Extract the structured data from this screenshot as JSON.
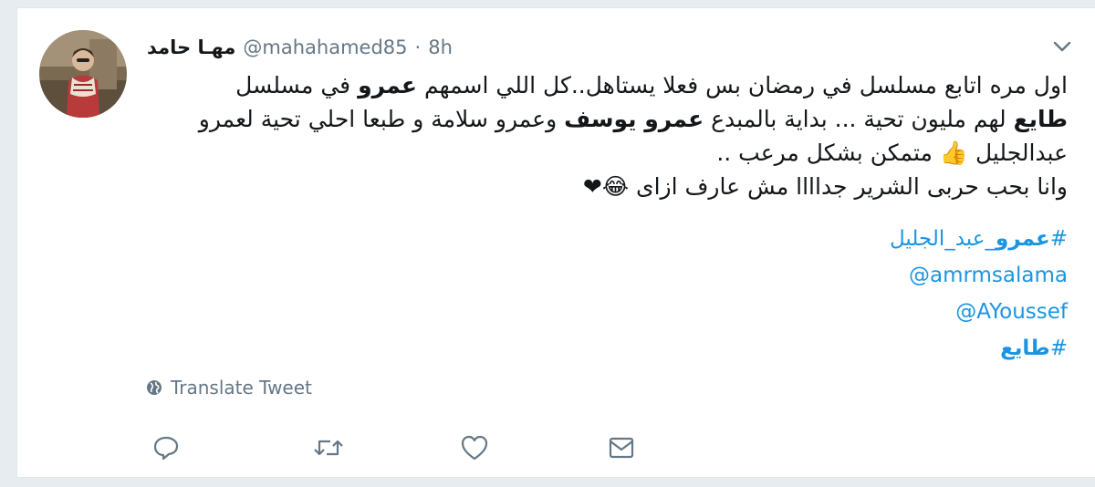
{
  "tweet": {
    "author_name": "مهـا حامد",
    "handle": "@mahahamed85",
    "separator": "·",
    "time": "8h",
    "line1a": "اول مره اتابع مسلسل في رمضان بس فعلا يستاهل..كل اللي اسمهم ",
    "line1b": "عمرو",
    "line1c": " في مسلسل",
    "line2a": "طايع",
    "line2b": " لهم مليون تحية ... بداية بالمبدع ",
    "line2c": "عمرو يوسف",
    "line2d": " وعمرو سلامة و طبعا احلي تحية لعمرو",
    "line3": "عبدالجليل 👍 متمكن بشكل مرعب ..",
    "line4": "وانا بحب حربى الشرير جداااا مش عارف ازاى 😂❤",
    "hashtag1_hash": "#",
    "hashtag1_bold": "عمرو",
    "hashtag1_rest": "_عبد_الجليل",
    "mention1": "@amrmsalama",
    "mention2": "@AYoussef",
    "hashtag2_hash": "#",
    "hashtag2_text": "طايع",
    "translate_label": "Translate Tweet"
  },
  "icons": {
    "reply": "reply-icon",
    "retweet": "retweet-icon",
    "like": "heart-icon",
    "dm": "envelope-icon",
    "menu": "chevron-down-icon",
    "globe": "globe-icon"
  },
  "colors": {
    "link": "#1b95e0",
    "secondary": "#657786",
    "text": "#14171a"
  }
}
